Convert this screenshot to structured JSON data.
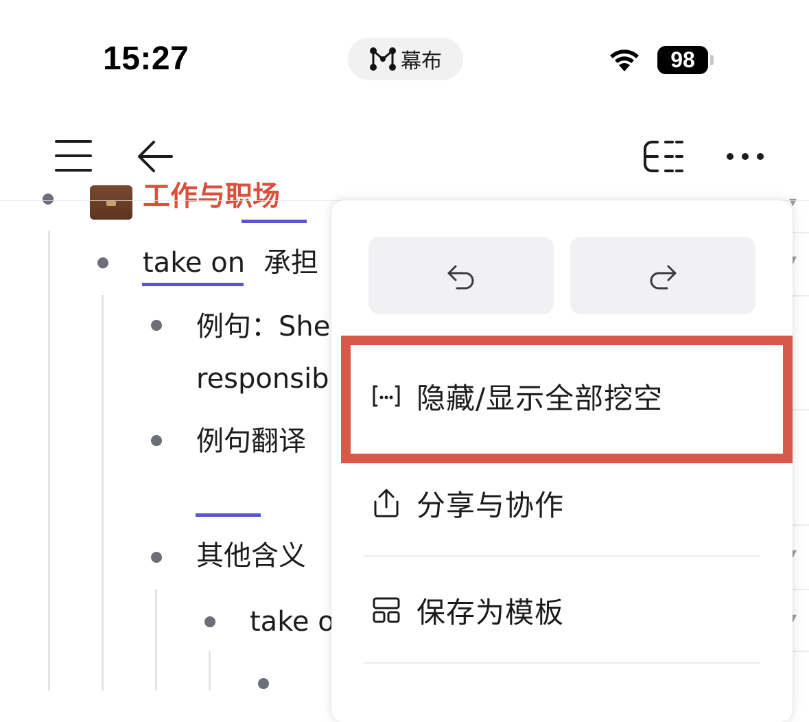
{
  "status_bar": {
    "time": "15:27",
    "app_pill_label": "幕布",
    "battery": "98"
  },
  "outline": {
    "header": "工作与职场",
    "take_on": "take on",
    "take_on_meaning": "承担",
    "example_line1": "例句：She",
    "example_line2": "responsib",
    "translation_label": "例句翻译",
    "other_meanings_label": "其他含义",
    "sub_take_on": "take o"
  },
  "menu": {
    "items": [
      {
        "label": "隐藏/显示全部挖空",
        "icon": "cloze-bracket-icon"
      },
      {
        "label": "分享与协作",
        "icon": "share-icon"
      },
      {
        "label": "保存为模板",
        "icon": "template-icon"
      }
    ]
  },
  "colors": {
    "accent_underline": "#5a55d8",
    "header_red": "#d9503c",
    "highlight_box": "#d8584a"
  }
}
